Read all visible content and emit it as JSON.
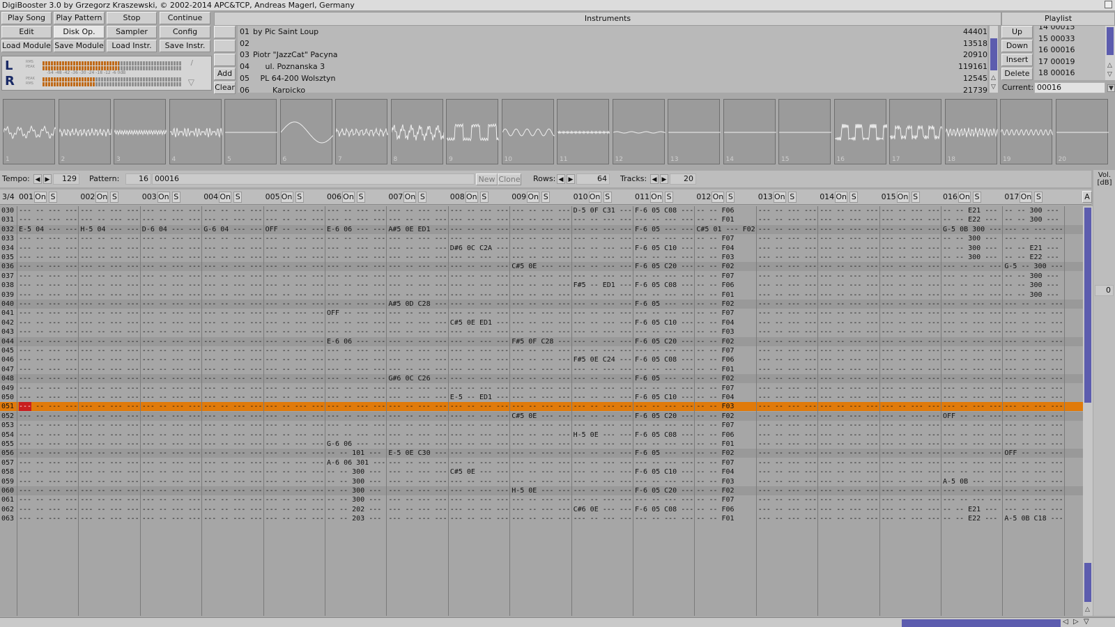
{
  "window": {
    "title": "DigiBooster 3.0 by Grzegorz Kraszewski, © 2002-2014 APC&TCP, Andreas Magerl, Germany"
  },
  "buttons": {
    "play_song": "Play Song",
    "play_pattern": "Play Pattern",
    "stop": "Stop",
    "continue": "Continue",
    "edit": "Edit",
    "disk_op": "Disk Op.",
    "sampler": "Sampler",
    "config": "Config",
    "load_module": "Load Module",
    "save_module": "Save Module",
    "load_instr": "Load Instr.",
    "save_instr": "Save Instr.",
    "add": "Add",
    "clear": "Clear"
  },
  "instruments": {
    "header": "Instruments",
    "items": [
      {
        "num": "01",
        "name": "by Pic Saint Loup",
        "size": "44401"
      },
      {
        "num": "02",
        "name": "",
        "size": "13518"
      },
      {
        "num": "03",
        "name": "Piotr \"JazzCat\" Pacyna",
        "size": "20910"
      },
      {
        "num": "04",
        "name": "     ul. Poznanska 3",
        "size": "119161"
      },
      {
        "num": "05",
        "name": "   PL 64-200 Wolsztyn",
        "size": "12545"
      },
      {
        "num": "06",
        "name": "        Karpicko",
        "size": "21739"
      }
    ]
  },
  "playlist": {
    "header": "Playlist",
    "items": [
      "14 00015",
      "15 00033",
      "16 00016",
      "17 00019",
      "18 00016"
    ],
    "buttons": {
      "up": "Up",
      "down": "Down",
      "insert": "Insert",
      "delete": "Delete"
    },
    "current_label": "Current:",
    "current_value": "00016"
  },
  "vu": {
    "left": "L",
    "right": "R",
    "rms": "RMS",
    "peak": "PEAK",
    "scale": "-54 -48 -42 -36 -30 -24 -18 -12 -6  0dB",
    "left_level": 0.55,
    "right_level": 0.38
  },
  "scopes": [
    "1",
    "2",
    "3",
    "4",
    "5",
    "6",
    "7",
    "8",
    "9",
    "10",
    "11",
    "12",
    "13",
    "14",
    "15",
    "16",
    "17",
    "18",
    "19",
    "20"
  ],
  "controls": {
    "tempo_label": "Tempo:",
    "tempo_value": "129",
    "pattern_label": "Pattern:",
    "pattern_num": "16",
    "pattern_name": "00016",
    "new": "New",
    "clone": "Clone",
    "rows_label": "Rows:",
    "rows_value": "64",
    "tracks_label": "Tracks:",
    "tracks_value": "20",
    "vol_label": "Vol.",
    "vol_unit": "[dB]",
    "vol_value": "0"
  },
  "track_header": {
    "step": "3/4",
    "on": "On",
    "s": "S",
    "a": "A",
    "tracks": [
      "001",
      "002",
      "003",
      "004",
      "005",
      "006",
      "007",
      "008",
      "009",
      "010",
      "011",
      "012",
      "013",
      "014",
      "015",
      "016",
      "017"
    ]
  },
  "pattern": {
    "cursor_row": "051",
    "cursor_cell": "---",
    "rows": [
      {
        "n": "030",
        "c": {
          "10": "D-5 0F C31 ---",
          "11": "F-6 05 C08 ---",
          "12": "-- -- F06",
          "16": "-- -- E21 ---",
          "17": "-- -- 300 ---"
        }
      },
      {
        "n": "031",
        "c": {
          "12": "-- -- F01",
          "16": "-- -- E22 ---",
          "17": "-- -- 300 ---"
        }
      },
      {
        "n": "032",
        "c": {
          "1": "E-5 04 --- ---",
          "2": "H-5 04 --- ---",
          "3": "D-6 04 --- ---",
          "4": "G-6 04 --- ---",
          "5": "OFF -- --- ---",
          "6": "E-6 06 --- ---",
          "7": "A#5 0E ED1 ---",
          "11": "F-6 05 --- ---",
          "12": "C#5 01 --- F02",
          "16": "G-5 0B 300 ---"
        }
      },
      {
        "n": "033",
        "c": {
          "12": "-- -- F07",
          "16": "-- -- 300 ---"
        }
      },
      {
        "n": "034",
        "c": {
          "8": "D#6 0C C2A ---",
          "11": "F-6 05 C10 ---",
          "12": "-- -- F04",
          "16": "-- -- 300 ---",
          "17": "-- -- E21 ---"
        }
      },
      {
        "n": "035",
        "c": {
          "12": "-- -- F03",
          "16": "-- -- 300 ---",
          "17": "-- -- E22 ---"
        }
      },
      {
        "n": "036",
        "c": {
          "9": "C#5 0E --- ---",
          "11": "F-6 05 C20 ---",
          "12": "-- -- F02",
          "17": "G-5 -- 300 ---"
        }
      },
      {
        "n": "037",
        "c": {
          "12": "-- -- F07",
          "17": "-- -- 300 ---"
        }
      },
      {
        "n": "038",
        "c": {
          "10": "F#5 -- ED1 ---",
          "11": "F-6 05 C08 ---",
          "12": "-- -- F06",
          "17": "-- -- 300 ---"
        }
      },
      {
        "n": "039",
        "c": {
          "12": "-- -- F01",
          "17": "-- -- 300 ---"
        }
      },
      {
        "n": "040",
        "c": {
          "7": "A#5 0D C28 ---",
          "11": "F-6 05 --- ---",
          "12": "-- -- F02"
        }
      },
      {
        "n": "041",
        "c": {
          "6": "OFF -- --- ---",
          "12": "-- -- F07"
        }
      },
      {
        "n": "042",
        "c": {
          "8": "C#5 0E ED1 ---",
          "11": "F-6 05 C10 ---",
          "12": "-- -- F04"
        }
      },
      {
        "n": "043",
        "c": {
          "12": "-- -- F03"
        }
      },
      {
        "n": "044",
        "c": {
          "6": "E-6 06 --- ---",
          "9": "F#5 0F C28 ---",
          "11": "F-6 05 C20 ---",
          "12": "-- -- F02"
        }
      },
      {
        "n": "045",
        "c": {
          "12": "-- -- F07"
        }
      },
      {
        "n": "046",
        "c": {
          "10": "F#5 0E C24 ---",
          "11": "F-6 05 C08 ---",
          "12": "-- -- F06"
        }
      },
      {
        "n": "047",
        "c": {
          "12": "-- -- F01"
        }
      },
      {
        "n": "048",
        "c": {
          "7": "G#6 0C C26 ---",
          "11": "F-6 05 --- ---",
          "12": "-- -- F02"
        }
      },
      {
        "n": "049",
        "c": {
          "12": "-- -- F07"
        }
      },
      {
        "n": "050",
        "c": {
          "8": "E-5 -- ED1 ---",
          "11": "F-6 05 C10 ---",
          "12": "-- -- F04"
        }
      },
      {
        "n": "051",
        "c": {
          "12": "-- -- F03"
        }
      },
      {
        "n": "052",
        "c": {
          "9": "C#5 0E --- ---",
          "11": "F-6 05 C20 ---",
          "12": "-- -- F02",
          "16": "OFF -- --- ---"
        }
      },
      {
        "n": "053",
        "c": {
          "12": "-- -- F07"
        }
      },
      {
        "n": "054",
        "c": {
          "10": "H-5 0E --- ---",
          "11": "F-6 05 C08 ---",
          "12": "-- -- F06"
        }
      },
      {
        "n": "055",
        "c": {
          "6": "G-6 06 --- ---",
          "12": "-- -- F01"
        }
      },
      {
        "n": "056",
        "c": {
          "6": "-- -- 101 ---",
          "7": "E-5 0E C30 ---",
          "11": "F-6 05 --- ---",
          "12": "-- -- F02",
          "17": "OFF -- --- ---"
        }
      },
      {
        "n": "057",
        "c": {
          "6": "A-6 06 301 ---",
          "12": "-- -- F07"
        }
      },
      {
        "n": "058",
        "c": {
          "6": "-- -- 300 ---",
          "8": "C#5 0E --- ---",
          "11": "F-6 05 C10 ---",
          "12": "-- -- F04"
        }
      },
      {
        "n": "059",
        "c": {
          "6": "-- -- 300 ---",
          "12": "-- -- F03",
          "16": "A-5 0B --- ---"
        }
      },
      {
        "n": "060",
        "c": {
          "6": "-- -- 300 ---",
          "9": "H-5 0E --- ---",
          "11": "F-6 05 C20 ---",
          "12": "-- -- F02"
        }
      },
      {
        "n": "061",
        "c": {
          "6": "-- -- 300 ---",
          "12": "-- -- F07"
        }
      },
      {
        "n": "062",
        "c": {
          "6": "-- -- 202 ---",
          "10": "C#6 0E --- ---",
          "11": "F-6 05 C08 ---",
          "12": "-- -- F06",
          "16": "-- -- E21 ---"
        }
      },
      {
        "n": "063",
        "c": {
          "6": "-- -- 203 ---",
          "12": "-- -- F01",
          "16": "-- -- E22 ---",
          "17": "A-5 0B C18 ---"
        }
      }
    ]
  }
}
